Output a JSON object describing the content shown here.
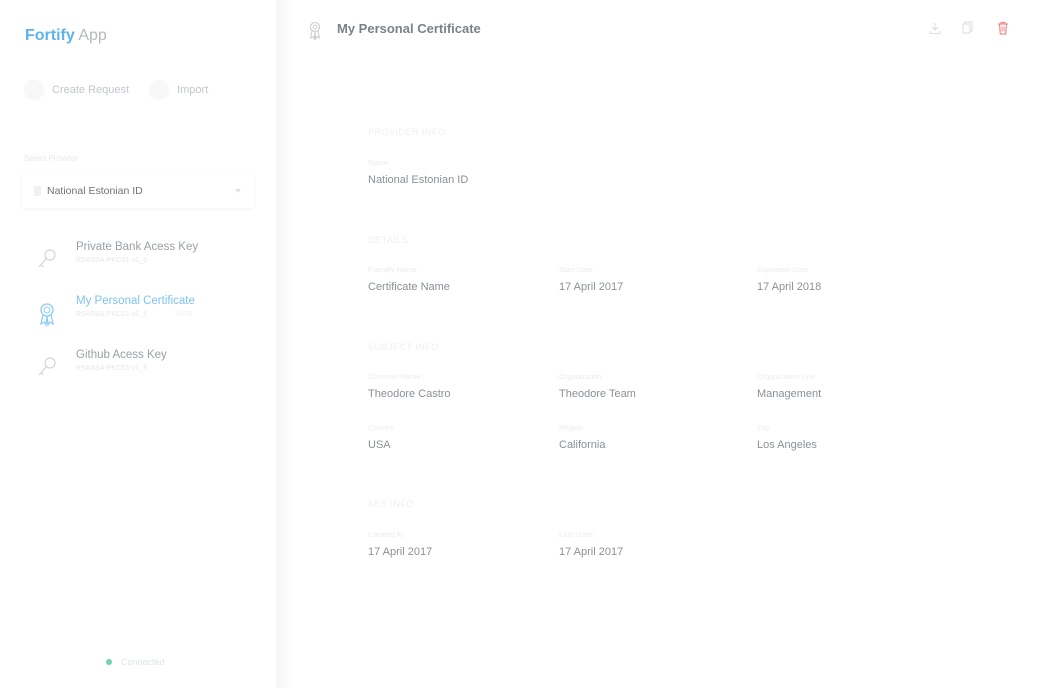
{
  "app": {
    "brand": "Fortify",
    "name": "App"
  },
  "sidebar": {
    "actions": {
      "create": "Create Request",
      "import": "Import"
    },
    "select_label": "Select Provider",
    "provider": "National Estonian ID",
    "items": [
      {
        "title": "Private Bank Acess Key",
        "sub": "RSASSA-PKCS1-v1_5",
        "icon": "key-icon"
      },
      {
        "title": "My Personal Certificate",
        "sub": "RSASSA-PKCS1-v1_5",
        "tag": "X509",
        "icon": "certificate-icon"
      },
      {
        "title": "Github Acess Key",
        "sub": "RSASSA-PKCS1-v1_5",
        "icon": "key-icon"
      }
    ],
    "status": "Connected"
  },
  "header": {
    "title": "My Personal Certificate",
    "tools": [
      "download-icon",
      "copy-icon",
      "delete-icon"
    ]
  },
  "provider_info": {
    "title": "PROVIDER INFO",
    "name_label": "Name",
    "name_value": "National Estonian ID"
  },
  "details": {
    "title": "DETAILS",
    "friendly_label": "Friendly Name",
    "friendly_value": "Certificate Name",
    "start_label": "Start Date",
    "start_value": "17 April 2017",
    "exp_label": "Expiration Date",
    "exp_value": "17 April 2018"
  },
  "subject_info": {
    "title": "SUBJECT INFO",
    "cn_label": "Common Name",
    "cn_value": "Theodore Castro",
    "org_label": "Organization",
    "org_value": "Theodore Team",
    "ou_label": "Organization Unit",
    "ou_value": "Management",
    "country_label": "Country",
    "country_value": "USA",
    "region_label": "Region",
    "region_value": "California",
    "city_label": "City",
    "city_value": "Los Angeles"
  },
  "key_info": {
    "title": "KEY INFO",
    "created_label": "Created At",
    "created_value": "17 April 2017",
    "used_label": "Last Used",
    "used_value": "17 April 2017"
  },
  "colors": {
    "accent": "#5eb4ea",
    "delete": "#f08a8a",
    "status": "#6fd6aa"
  }
}
